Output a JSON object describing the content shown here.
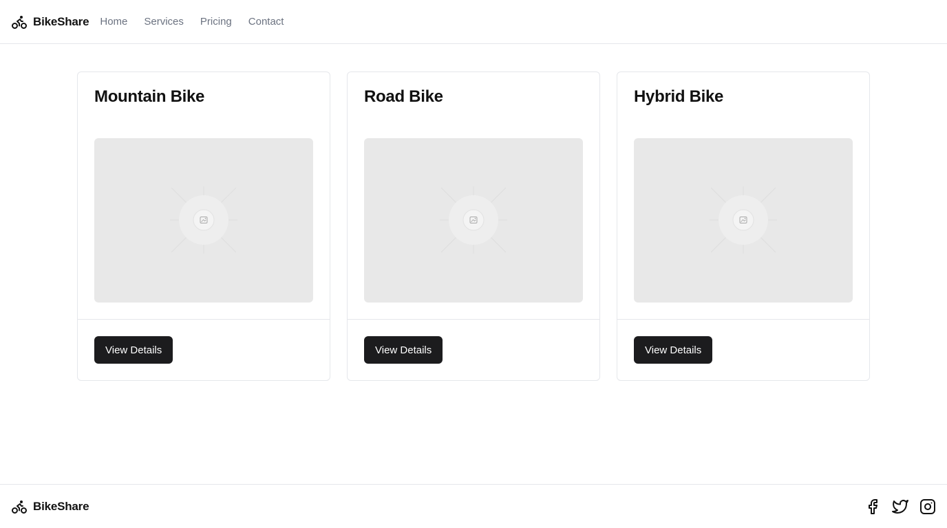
{
  "header": {
    "brand": {
      "name": "BikeShare",
      "icon": "bike-icon"
    },
    "nav": [
      {
        "label": "Home"
      },
      {
        "label": "Services"
      },
      {
        "label": "Pricing"
      },
      {
        "label": "Contact"
      }
    ]
  },
  "cards": [
    {
      "title": "Mountain Bike",
      "button_label": "View Details",
      "image_icon": "image-placeholder-icon"
    },
    {
      "title": "Road Bike",
      "button_label": "View Details",
      "image_icon": "image-placeholder-icon"
    },
    {
      "title": "Hybrid Bike",
      "button_label": "View Details",
      "image_icon": "image-placeholder-icon"
    }
  ],
  "footer": {
    "brand": {
      "name": "BikeShare",
      "icon": "bike-icon"
    },
    "socials": [
      {
        "icon": "facebook-icon"
      },
      {
        "icon": "twitter-icon"
      },
      {
        "icon": "instagram-icon"
      }
    ]
  },
  "colors": {
    "button_bg": "#1c1c1e",
    "nav_text": "#6b7280",
    "border": "#e5e7eb",
    "placeholder_bg": "#e8e8e8"
  }
}
